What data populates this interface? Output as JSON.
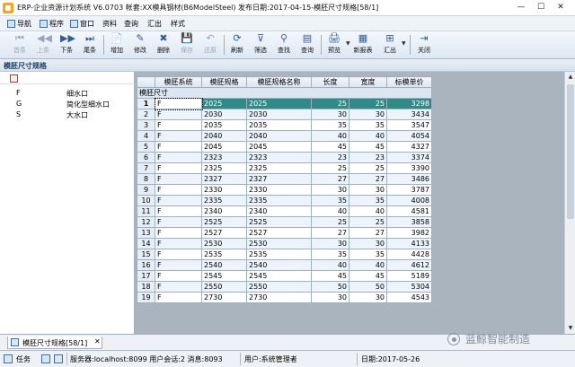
{
  "window": {
    "title": "ERP-企业资源计划系统 V6.0703 帐套:XX模具钢材(B6ModelSteel) 发布日期:2017-04-15-模胚尺寸规格[58/1]",
    "min": "—",
    "max": "☐",
    "close": "✕"
  },
  "menu": [
    {
      "label": "导航",
      "icon": "navigation-icon"
    },
    {
      "label": "程序",
      "icon": "program-icon"
    },
    {
      "label": "窗口",
      "icon": "window-icon"
    },
    {
      "label": "资料"
    },
    {
      "label": "查询"
    },
    {
      "label": "汇出"
    },
    {
      "label": "样式"
    }
  ],
  "toolbar": [
    {
      "label": "首条",
      "glyph": "⏮",
      "enabled": false
    },
    {
      "label": "上条",
      "glyph": "◀◀",
      "enabled": false
    },
    {
      "label": "下条",
      "glyph": "▶▶",
      "enabled": true
    },
    {
      "label": "尾条",
      "glyph": "⏭",
      "enabled": true
    },
    {
      "label": "增加",
      "glyph": "📄",
      "enabled": true
    },
    {
      "label": "修改",
      "glyph": "✎",
      "enabled": true
    },
    {
      "label": "删除",
      "glyph": "✖",
      "enabled": true
    },
    {
      "label": "保存",
      "glyph": "💾",
      "enabled": false
    },
    {
      "label": "还原",
      "glyph": "↶",
      "enabled": false
    },
    {
      "label": "刷新",
      "glyph": "⟳",
      "enabled": true
    },
    {
      "label": "筛选",
      "glyph": "⊽",
      "enabled": true
    },
    {
      "label": "查找",
      "glyph": "⚲",
      "enabled": true
    },
    {
      "label": "查询",
      "glyph": "▤",
      "enabled": true
    },
    {
      "label": "预览",
      "glyph": "🖨",
      "enabled": true
    },
    {
      "label": "新报表",
      "glyph": "▦",
      "enabled": true
    },
    {
      "label": "汇出",
      "glyph": "⊞",
      "enabled": true
    },
    {
      "label": "关闭",
      "glyph": "⇥",
      "enabled": true
    }
  ],
  "section_title": "模胚尺寸规格",
  "left_panel": {
    "items": [
      {
        "code": "F",
        "name": "细水口"
      },
      {
        "code": "G",
        "name": "简化型细水口"
      },
      {
        "code": "S",
        "name": "大水口"
      }
    ]
  },
  "grid": {
    "caption": "模胚尺寸",
    "columns": [
      "模胚系统",
      "模胚规格",
      "模胚规格名称",
      "长度",
      "宽度",
      "标模单价"
    ],
    "rows": [
      [
        "1",
        "F",
        "2025",
        "2025",
        "25",
        "25",
        "3298"
      ],
      [
        "2",
        "F",
        "2030",
        "2030",
        "30",
        "30",
        "3434"
      ],
      [
        "3",
        "F",
        "2035",
        "2035",
        "35",
        "35",
        "3547"
      ],
      [
        "4",
        "F",
        "2040",
        "2040",
        "40",
        "40",
        "4054"
      ],
      [
        "5",
        "F",
        "2045",
        "2045",
        "45",
        "45",
        "4327"
      ],
      [
        "6",
        "F",
        "2323",
        "2323",
        "23",
        "23",
        "3374"
      ],
      [
        "7",
        "F",
        "2325",
        "2325",
        "25",
        "25",
        "3390"
      ],
      [
        "8",
        "F",
        "2327",
        "2327",
        "27",
        "27",
        "3486"
      ],
      [
        "9",
        "F",
        "2330",
        "2330",
        "30",
        "30",
        "3787"
      ],
      [
        "10",
        "F",
        "2335",
        "2335",
        "35",
        "35",
        "4008"
      ],
      [
        "11",
        "F",
        "2340",
        "2340",
        "40",
        "40",
        "4581"
      ],
      [
        "12",
        "F",
        "2525",
        "2525",
        "25",
        "25",
        "3858"
      ],
      [
        "13",
        "F",
        "2527",
        "2527",
        "27",
        "27",
        "3982"
      ],
      [
        "14",
        "F",
        "2530",
        "2530",
        "30",
        "30",
        "4133"
      ],
      [
        "15",
        "F",
        "2535",
        "2535",
        "35",
        "35",
        "4428"
      ],
      [
        "16",
        "F",
        "2540",
        "2540",
        "40",
        "40",
        "4612"
      ],
      [
        "17",
        "F",
        "2545",
        "2545",
        "45",
        "45",
        "5189"
      ],
      [
        "18",
        "F",
        "2550",
        "2550",
        "50",
        "50",
        "5304"
      ],
      [
        "19",
        "F",
        "2730",
        "2730",
        "30",
        "30",
        "4543"
      ]
    ],
    "selected_row": 1
  },
  "tab": {
    "label": "模胚尺寸规格[58/1]",
    "close": "✕"
  },
  "watermark": "蓝鲸智能制造",
  "status": {
    "task": "任务",
    "server": "服务器:localhost:8099 用户会话:2 消息:8093",
    "user": "用户:系统管理者",
    "date": "日期:2017-05-26"
  },
  "colors": {
    "selected_row": "#2e8b85",
    "alt_row": "#edf3fb",
    "grid_bg": "#aab4bf"
  }
}
